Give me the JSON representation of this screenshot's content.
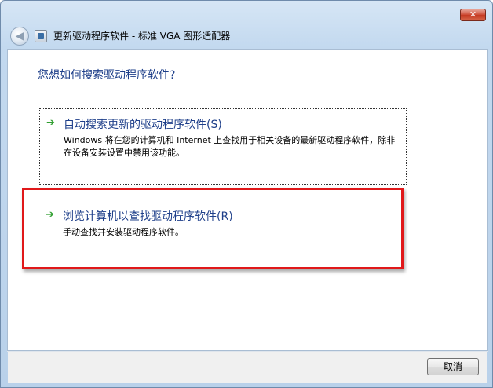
{
  "window": {
    "title": "更新驱动程序软件 - 标准 VGA 图形适配器",
    "close_label": "✕",
    "back_label": "◀"
  },
  "main": {
    "question": "您想如何搜索驱动程序软件?",
    "options": [
      {
        "title": "自动搜索更新的驱动程序软件(S)",
        "description": "Windows 将在您的计算机和 Internet 上查找用于相关设备的最新驱动程序软件，除非在设备安装设置中禁用该功能。",
        "icon": "green-arrow-icon"
      },
      {
        "title": "浏览计算机以查找驱动程序软件(R)",
        "description": "手动查找并安装驱动程序软件。",
        "icon": "green-arrow-icon"
      }
    ]
  },
  "footer": {
    "cancel_label": "取消"
  },
  "colors": {
    "link_blue": "#1e3f8a",
    "arrow_green": "#2f9e2f",
    "highlight_red": "#e0181a"
  }
}
